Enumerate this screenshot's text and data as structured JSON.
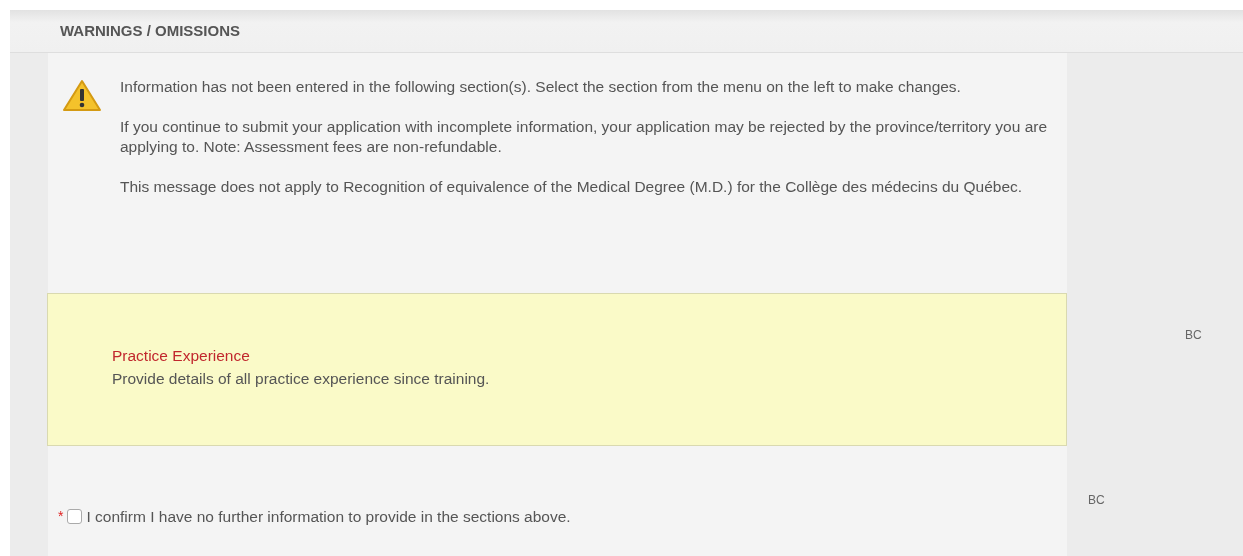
{
  "section_title": "WARNINGS / OMISSIONS",
  "warning": {
    "paragraphs": [
      "Information has not been entered in the following section(s). Select the section from the menu on the left to make changes.",
      "If you continue to submit your application with incomplete information, your application may be rejected by the province/territory you are applying to. Note: Assessment fees are non-refundable.",
      "This message does not apply to Recognition of equivalence of the Medical Degree (M.D.) for the Collège des médecins du Québec."
    ]
  },
  "omissions": [
    {
      "title": "Practice Experience",
      "description": "Provide details of all practice experience since training.",
      "province": "BC"
    }
  ],
  "confirm": {
    "required_mark": "*",
    "label": "I confirm I have no further information to provide in the sections above.",
    "checked": false,
    "province": "BC"
  }
}
